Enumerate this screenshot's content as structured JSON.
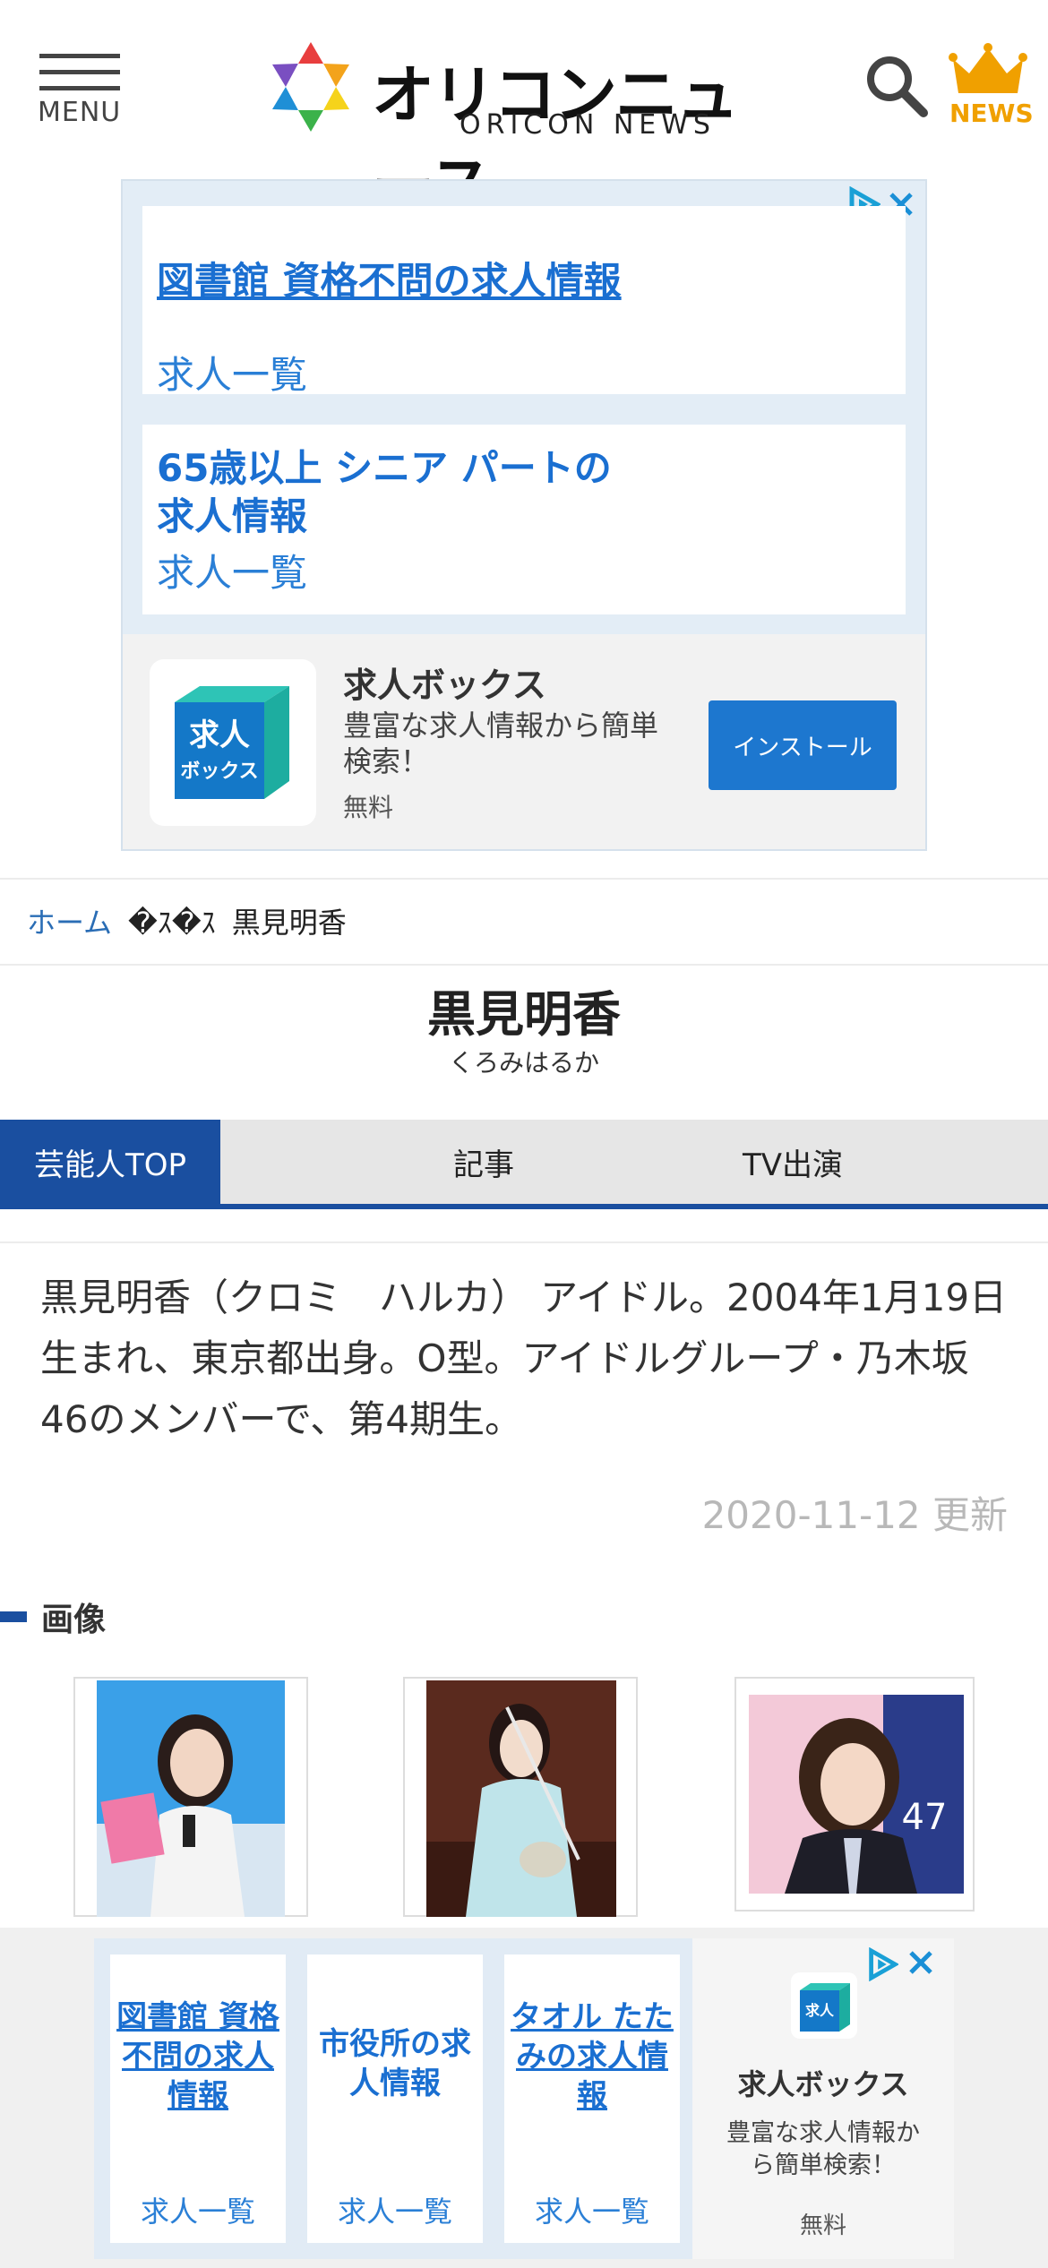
{
  "header": {
    "menu_label": "MENU",
    "logo_jp": "オリコンニュース",
    "logo_en": "ORICON NEWS",
    "news_label": "NEWS"
  },
  "ad_top": {
    "card1": {
      "title": "図書館 資格不問の求人情報",
      "sub": "求人一覧"
    },
    "card2": {
      "title_line1": "65歳以上 シニア パートの",
      "title_line2": "求人情報",
      "sub": "求人一覧"
    },
    "app": {
      "icon_line1": "求人",
      "icon_line2": "ボックス",
      "name": "求人ボックス",
      "desc": "豊富な求人情報から簡単検索！",
      "price": "無料",
      "install": "インストール"
    }
  },
  "breadcrumb": {
    "home": "ホーム",
    "section": "�ｽ�ｽ",
    "current": "黒見明香"
  },
  "profile": {
    "name": "黒見明香",
    "reading": "くろみはるか",
    "description": "黒見明香（クロミ　ハルカ） アイドル。2004年1月19日生まれ、東京都出身。O型。アイドルグループ・乃木坂46のメンバーで、第4期生。",
    "updated": "2020-11-12 更新"
  },
  "tabs": [
    {
      "label": "芸能人TOP"
    },
    {
      "label": "記事"
    },
    {
      "label": "TV出演"
    }
  ],
  "images_section": {
    "heading": "画像"
  },
  "ad_bottom": {
    "cards": [
      {
        "title": "図書館 資格不問の求人情報",
        "sub": "求人一覧"
      },
      {
        "title": "市役所の求人情報",
        "sub": "求人一覧"
      },
      {
        "title": "タオル たたみの求人情報",
        "sub": "求人一覧"
      }
    ],
    "app": {
      "icon_label": "求人",
      "name": "求人ボックス",
      "desc": "豊富な求人情報から簡単検索！",
      "price": "無料"
    }
  },
  "colors": {
    "brand_blue": "#1a4fa0",
    "link_blue": "#1a6fd1",
    "crown_orange": "#f0a000"
  },
  "icons": [
    "menu-icon",
    "logo-mark-icon",
    "search-icon",
    "crown-icon",
    "adchoices-icon",
    "close-icon"
  ]
}
